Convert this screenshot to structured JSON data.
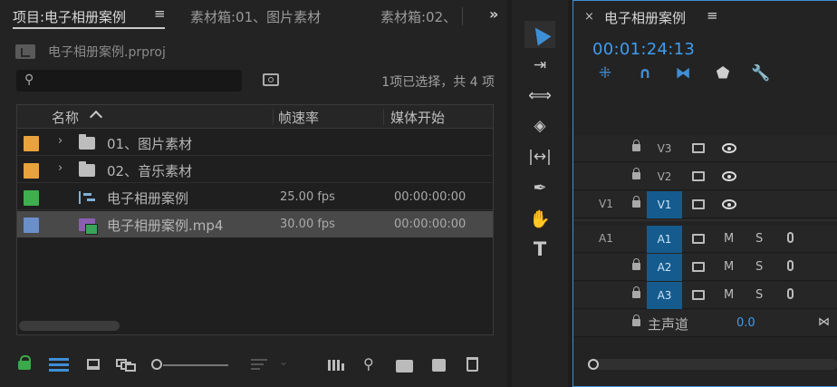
{
  "project_panel": {
    "tabs": [
      {
        "label": "项目:电子相册案例"
      },
      {
        "label": "素材箱:01、图片素材"
      },
      {
        "label": "素材箱:02、"
      }
    ],
    "project_file": "电子相册案例.prproj",
    "search": {
      "value": "",
      "placeholder": ""
    },
    "selection_status": "1项已选择，共 4 项",
    "columns": {
      "name": "名称",
      "fps": "帧速率",
      "media_start": "媒体开始"
    },
    "items": [
      {
        "name": "01、图片素材",
        "fps": "",
        "media_start": "",
        "type": "bin",
        "label_color": "#e8a33d",
        "selected": false
      },
      {
        "name": "02、音乐素材",
        "fps": "",
        "media_start": "",
        "type": "bin",
        "label_color": "#e8a33d",
        "selected": false
      },
      {
        "name": "电子相册案例",
        "fps": "25.00 fps",
        "media_start": "00:00:00:00",
        "type": "sequence",
        "label_color": "#3fae4e",
        "selected": false
      },
      {
        "name": "电子相册案例.mp4",
        "fps": "30.00 fps",
        "media_start": "00:00:00:00",
        "type": "media",
        "label_color": "#6b8fc8",
        "selected": true
      }
    ]
  },
  "tools": [
    {
      "name": "selection-tool",
      "icon": "arrow-icon",
      "active": true
    },
    {
      "name": "track-select-tool",
      "icon": "track-select-icon",
      "active": false
    },
    {
      "name": "ripple-edit-tool",
      "icon": "ripple-edit-icon",
      "active": false
    },
    {
      "name": "razor-tool",
      "icon": "razor-icon",
      "active": false
    },
    {
      "name": "slip-tool",
      "icon": "slip-icon",
      "active": false
    },
    {
      "name": "pen-tool",
      "icon": "pen-icon",
      "active": false
    },
    {
      "name": "hand-tool",
      "icon": "hand-icon",
      "active": false
    },
    {
      "name": "type-tool",
      "icon": "type-icon",
      "active": false,
      "glyph": "T"
    }
  ],
  "timeline": {
    "title": "电子相册案例",
    "timecode": "00:01:24:13",
    "video_tracks": [
      {
        "name": "V3",
        "source": "",
        "targeted": false
      },
      {
        "name": "V2",
        "source": "",
        "targeted": false
      },
      {
        "name": "V1",
        "source": "V1",
        "targeted": true
      }
    ],
    "audio_tracks": [
      {
        "name": "A1",
        "source": "A1",
        "targeted": true,
        "mute": "M",
        "solo": "S"
      },
      {
        "name": "A2",
        "source": "",
        "targeted": true,
        "mute": "M",
        "solo": "S"
      },
      {
        "name": "A3",
        "source": "",
        "targeted": true,
        "mute": "M",
        "solo": "S"
      }
    ],
    "master": {
      "label": "主声道",
      "value": "0.0"
    }
  },
  "colors": {
    "accent": "#3f8fd6",
    "timecode": "#3f9cf0",
    "track_target": "#155b8d"
  }
}
